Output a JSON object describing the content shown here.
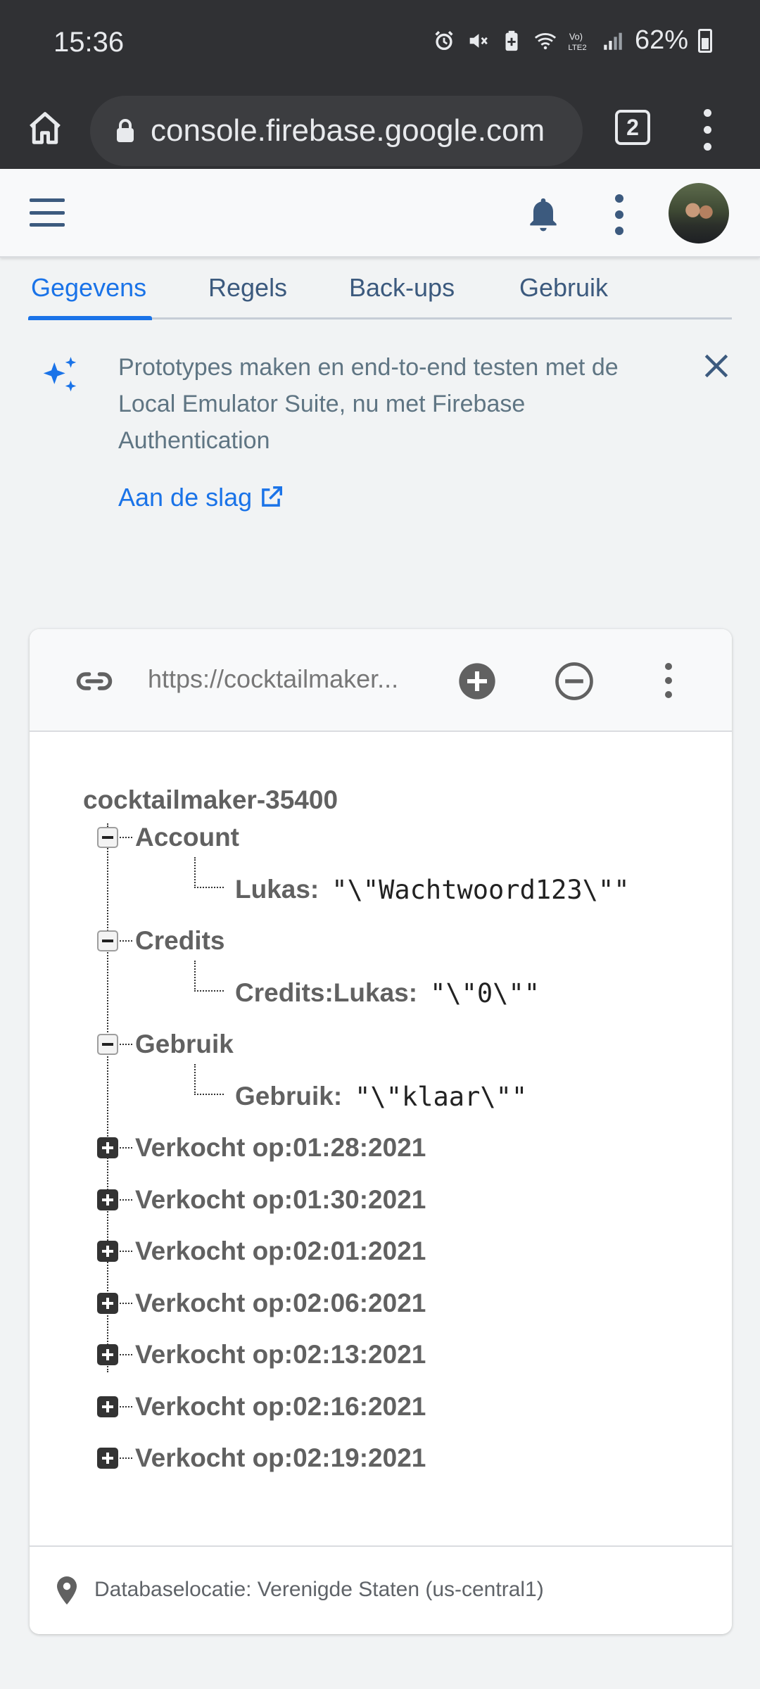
{
  "status_bar": {
    "time": "15:36",
    "battery": "62%"
  },
  "browser": {
    "url": "console.firebase.google.com",
    "tab_count": "2"
  },
  "tabs": [
    {
      "label": "Gegevens",
      "active": true
    },
    {
      "label": "Regels",
      "active": false
    },
    {
      "label": "Back-ups",
      "active": false
    },
    {
      "label": "Gebruik",
      "active": false
    }
  ],
  "banner": {
    "text": "Prototypes maken en end-to-end testen met de Local Emulator Suite, nu met Firebase Authentication",
    "link": "Aan de slag"
  },
  "database": {
    "url": "https://cocktailmaker...",
    "root": "cocktailmaker-35400",
    "nodes": [
      {
        "key": "Account",
        "expanded": true,
        "child_key": "Lukas:",
        "child_value": "\"\\\"Wachtwoord123\\\"\""
      },
      {
        "key": "Credits",
        "expanded": true,
        "child_key": "Credits:Lukas:",
        "child_value": "\"\\\"0\\\"\""
      },
      {
        "key": "Gebruik",
        "expanded": true,
        "child_key": "Gebruik:",
        "child_value": "\"\\\"klaar\\\"\""
      },
      {
        "key": "Verkocht op:01:28:2021",
        "expanded": false
      },
      {
        "key": "Verkocht op:01:30:2021",
        "expanded": false
      },
      {
        "key": "Verkocht op:02:01:2021",
        "expanded": false
      },
      {
        "key": "Verkocht op:02:06:2021",
        "expanded": false
      },
      {
        "key": "Verkocht op:02:13:2021",
        "expanded": false
      },
      {
        "key": "Verkocht op:02:16:2021",
        "expanded": false
      },
      {
        "key": "Verkocht op:02:19:2021",
        "expanded": false
      }
    ],
    "location": "Databaselocatie: Verenigde Staten (us-central1)"
  },
  "colors": {
    "accent": "#1a73e8",
    "chrome": "#303134",
    "appbar_icon": "#3c5a7e"
  }
}
